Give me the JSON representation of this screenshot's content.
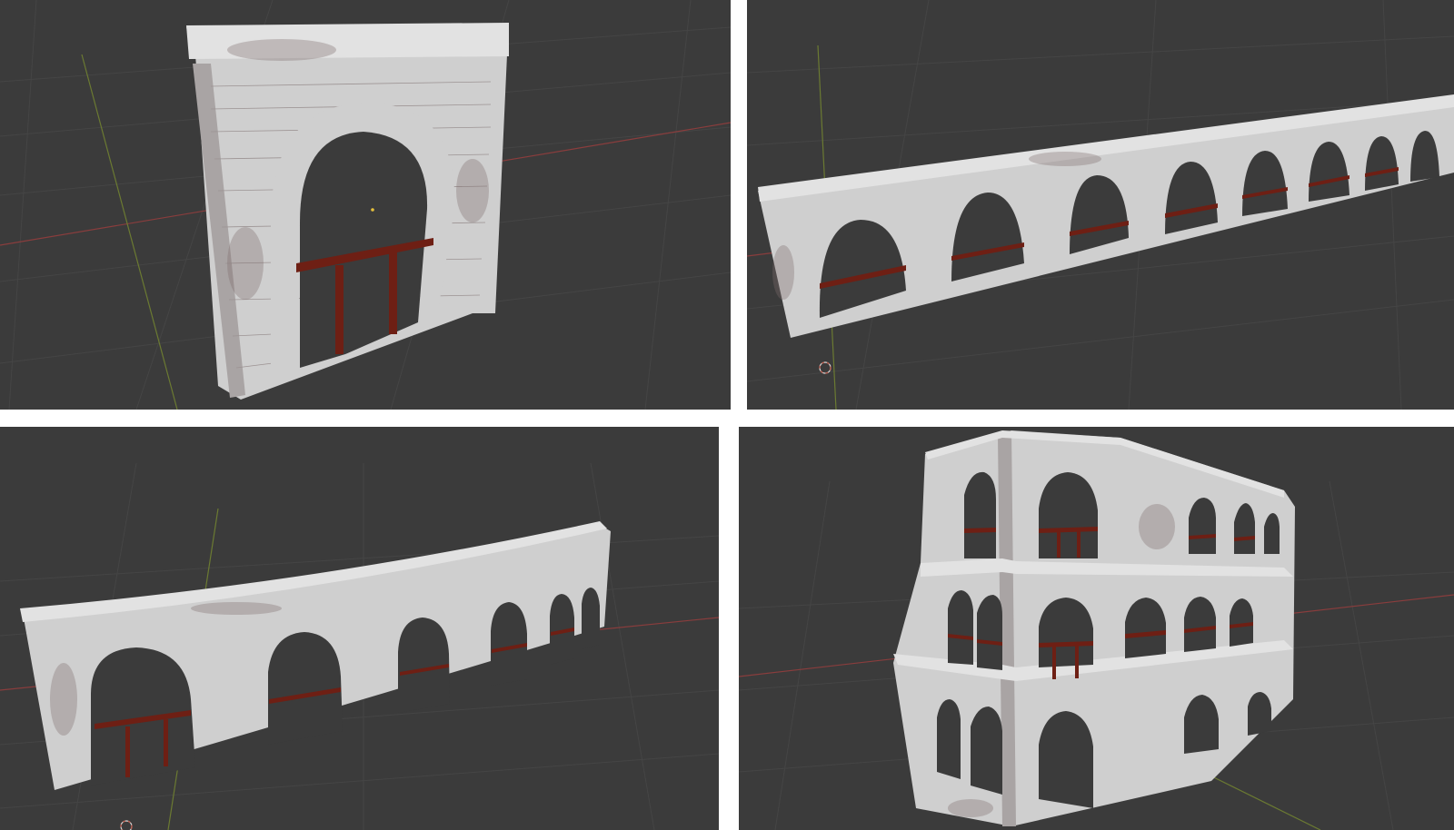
{
  "collage": {
    "background": "#ffffff",
    "viewport_background": "#3b3b3b",
    "panels": [
      {
        "id": "single-arch",
        "content": "single-arch-wall-module"
      },
      {
        "id": "straight-arcade",
        "content": "straight-arcade-wall"
      },
      {
        "id": "curved-arcade",
        "content": "curved-arcade-wall"
      },
      {
        "id": "three-tier-colosseum",
        "content": "three-tier-colosseum-section"
      }
    ]
  },
  "colors": {
    "stone": "#cfcfcf",
    "stone_shadow": "#a9a4a4",
    "railing": "#6e1f14",
    "x_axis": "#8a3d3d",
    "y_axis": "#6b7a32",
    "grid": "#454545"
  },
  "icons": {
    "cursor": "3d-cursor-icon",
    "origin": "object-origin-icon"
  }
}
